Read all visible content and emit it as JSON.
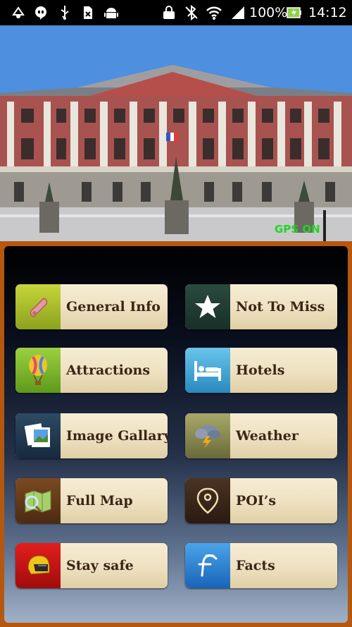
{
  "status_bar": {
    "battery_percent": "100%",
    "time": "14:12"
  },
  "hero": {
    "gps_label": "GPS ON"
  },
  "menu": {
    "left": [
      {
        "label": "General Info"
      },
      {
        "label": "Attractions"
      },
      {
        "label": "Image Gallary"
      },
      {
        "label": "Full Map"
      },
      {
        "label": "Stay safe"
      }
    ],
    "right": [
      {
        "label": "Not To Miss"
      },
      {
        "label": "Hotels"
      },
      {
        "label": "Weather"
      },
      {
        "label": "POI’s"
      },
      {
        "label": "Facts"
      }
    ]
  },
  "colors": {
    "panel_border": "#b5570e",
    "tile_bg": "#efe2c3",
    "tile_text": "#3a2516",
    "gps_text": "#23d423"
  },
  "icons": {
    "general_info": "scroll-icon",
    "not_to_miss": "star-icon",
    "attractions": "balloon-icon",
    "hotels": "bed-icon",
    "image_gallary": "photos-icon",
    "weather": "storm-cloud-icon",
    "full_map": "map-icon",
    "pois": "location-pin-icon",
    "stay_safe": "helmet-icon",
    "facts": "f-letter-icon"
  }
}
